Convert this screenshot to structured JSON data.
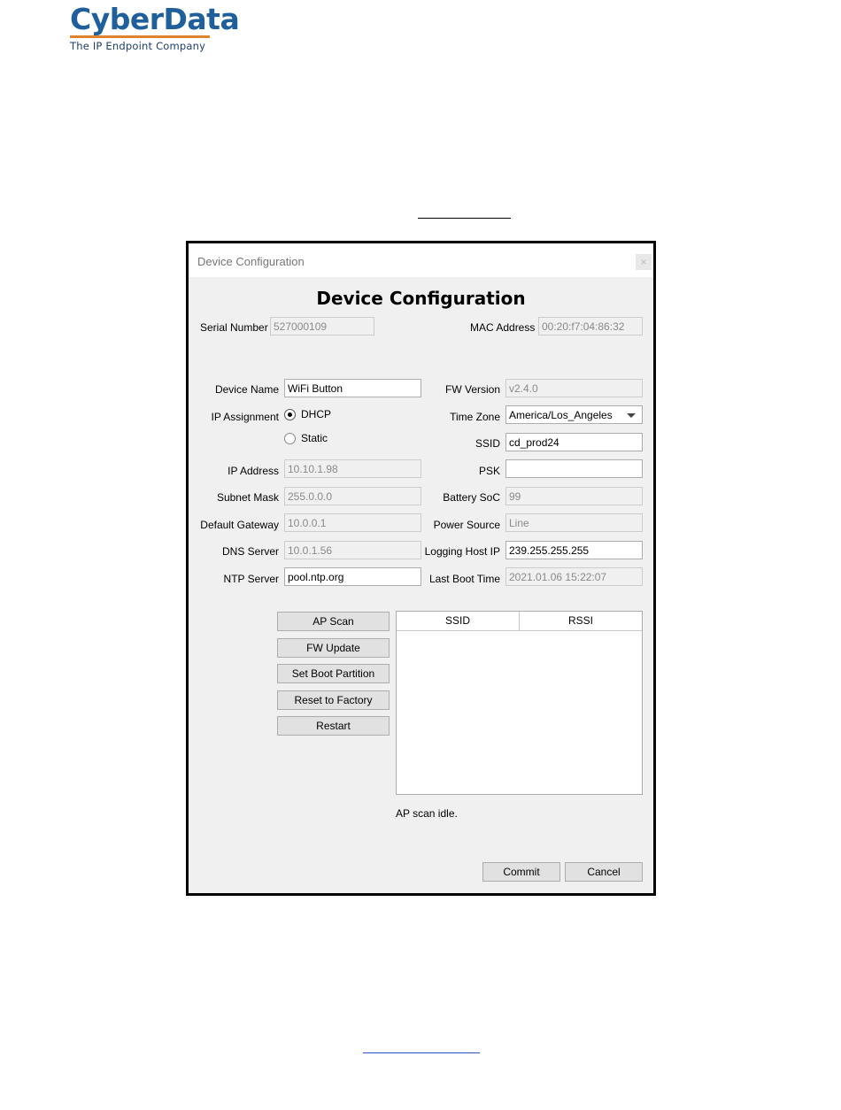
{
  "brand": {
    "name": "CyberData",
    "tagline": "The IP Endpoint Company"
  },
  "window": {
    "title": "Device Configuration",
    "close_label": "×"
  },
  "heading": "Device Configuration",
  "identity": {
    "serial_label": "Serial Number",
    "serial_value": "527000109",
    "mac_label": "MAC Address",
    "mac_value": "00:20:f7:04:86:32"
  },
  "left": {
    "device_name_label": "Device Name",
    "device_name_value": "WiFi Button",
    "ip_assignment_label": "IP Assignment",
    "dhcp_label": "DHCP",
    "static_label": "Static",
    "selected": "DHCP",
    "ip_address_label": "IP Address",
    "ip_address_value": "10.10.1.98",
    "subnet_label": "Subnet Mask",
    "subnet_value": "255.0.0.0",
    "gateway_label": "Default Gateway",
    "gateway_value": "10.0.0.1",
    "dns_label": "DNS Server",
    "dns_value": "10.0.1.56",
    "ntp_label": "NTP Server",
    "ntp_value": "pool.ntp.org"
  },
  "right": {
    "fw_label": "FW Version",
    "fw_value": "v2.4.0",
    "tz_label": "Time Zone",
    "tz_value": "America/Los_Angeles",
    "ssid_label": "SSID",
    "ssid_value": "cd_prod24",
    "psk_label": "PSK",
    "psk_value": "",
    "battery_label": "Battery SoC",
    "battery_value": "99",
    "power_label": "Power Source",
    "power_value": "Line",
    "logging_label": "Logging Host IP",
    "logging_value": "239.255.255.255",
    "boot_label": "Last Boot Time",
    "boot_value": "2021.01.06 15:22:07"
  },
  "actions": {
    "ap_scan": "AP Scan",
    "fw_update": "FW Update",
    "set_boot": "Set Boot Partition",
    "reset": "Reset to Factory",
    "restart": "Restart"
  },
  "scan_table": {
    "columns": [
      "SSID",
      "RSSI"
    ],
    "rows": []
  },
  "status": "AP scan idle.",
  "footer": {
    "commit": "Commit",
    "cancel": "Cancel"
  }
}
